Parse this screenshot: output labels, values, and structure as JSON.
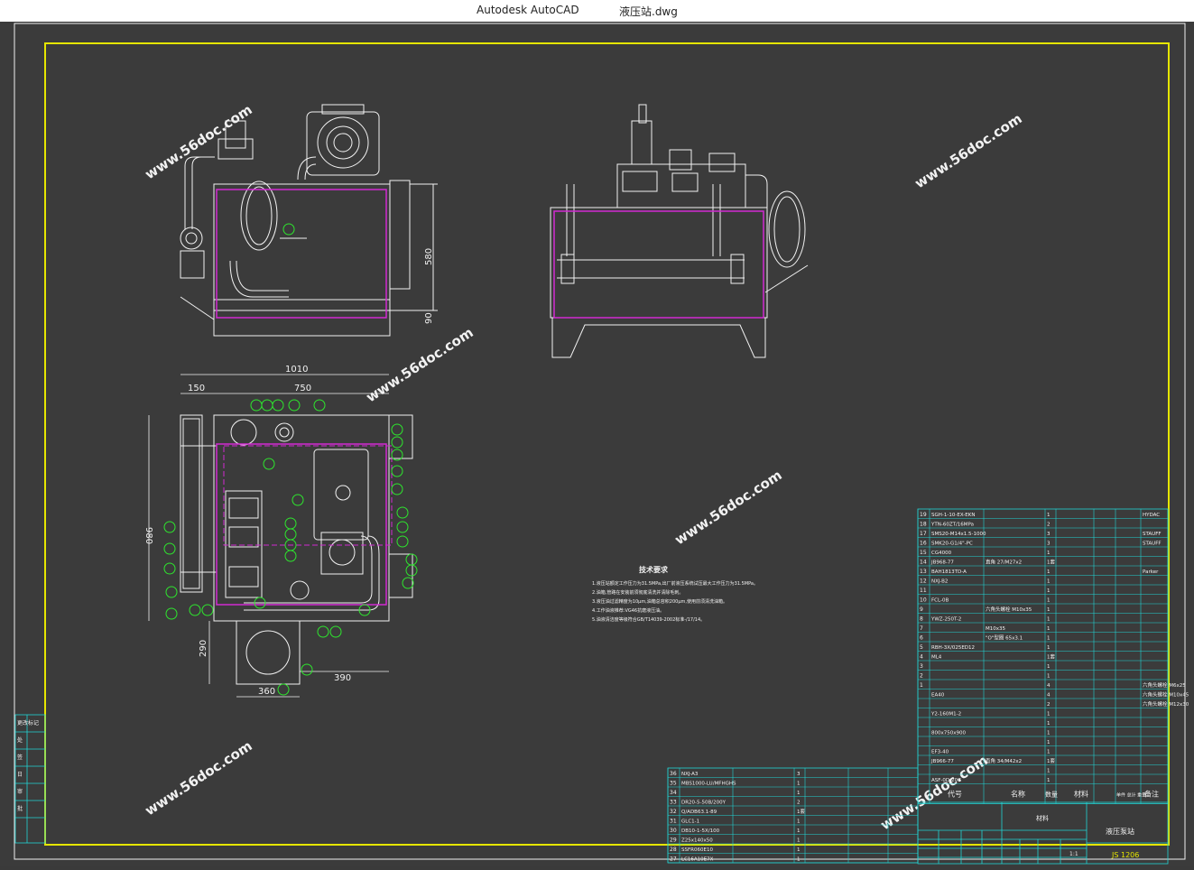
{
  "window": {
    "app_name": "Autodesk AutoCAD",
    "file_name": "液压站.dwg"
  },
  "watermark": "www.56doc.com",
  "colors": {
    "frame": "#e6e600",
    "drawing": "#f2f2f2",
    "magenta": "#d22ad2",
    "cyan": "#22d4d4",
    "green": "#2ee62e",
    "background": "#3b3b3b"
  },
  "dims": {
    "d1010": "1010",
    "d150": "150",
    "d750": "750",
    "d980": "980",
    "d290": "290",
    "d390": "390",
    "d360": "360",
    "d580": "580",
    "d90": "90"
  },
  "notes": {
    "title": "技术要求",
    "lines": [
      "1.液压站额定工作压力为31.5MPa,出厂前液压系统试压最大工作压力为31.5MPa。",
      "2.油箱,管路在安装前须彻底清洗并清除毛刺。",
      "3.液压油过滤精度为10μm,油箱总容积200μm,使用前须清洗油箱。",
      "4.工作油液推荐:VG46抗磨液压油。",
      "5.油液清洁度等级符合GB/T14039-2002标准-/17/14。"
    ]
  },
  "bom_right": {
    "header": {
      "no": "序号",
      "code": "代号",
      "name": "名称",
      "qty": "数量",
      "material": "材料",
      "weight": "单件 总计 重量",
      "remark": "备注"
    },
    "rows": [
      {
        "no": "19",
        "code": "SGH-1-10-EX-EKN",
        "name": "",
        "qty": "1",
        "remark": "HYDAC"
      },
      {
        "no": "18",
        "code": "YTN-60ZT/16MPa",
        "name": "",
        "qty": "2",
        "remark": ""
      },
      {
        "no": "17",
        "code": "SMS20-M14x1.5-1000",
        "name": "",
        "qty": "3",
        "remark": "STAUFF"
      },
      {
        "no": "16",
        "code": "SMK20-G1/4\"-PC",
        "name": "",
        "qty": "3",
        "remark": "STAUFF"
      },
      {
        "no": "15",
        "code": "CG4000",
        "name": "",
        "qty": "1",
        "remark": ""
      },
      {
        "no": "14",
        "code": "JB968-77",
        "name": "直角 27/M27x2",
        "qty": "1套",
        "remark": ""
      },
      {
        "no": "13",
        "code": "BAH1813TD-A",
        "name": "",
        "qty": "1",
        "remark": "Parker"
      },
      {
        "no": "12",
        "code": "NXJ-B2",
        "name": "",
        "qty": "1",
        "remark": ""
      },
      {
        "no": "11",
        "code": "",
        "name": "",
        "qty": "1",
        "remark": ""
      },
      {
        "no": "10",
        "code": "FCL-0B",
        "name": "",
        "qty": "1",
        "remark": ""
      },
      {
        "no": "9",
        "code": "",
        "name": "六角头螺栓 M10x35",
        "qty": "1",
        "remark": ""
      },
      {
        "no": "8",
        "code": "YWZ-250T-2",
        "name": "",
        "qty": "1",
        "remark": ""
      },
      {
        "no": "7",
        "code": "",
        "name": "M10x35",
        "qty": "1",
        "remark": ""
      },
      {
        "no": "6",
        "code": "",
        "name": "\"O\"型圈 65x3.1",
        "qty": "1",
        "remark": ""
      },
      {
        "no": "5",
        "code": "RBH-3X/025ED12",
        "name": "",
        "qty": "1",
        "remark": ""
      },
      {
        "no": "4",
        "code": "ML4",
        "name": "",
        "qty": "1套",
        "remark": ""
      },
      {
        "no": "3",
        "code": "",
        "name": "",
        "qty": "1",
        "remark": ""
      },
      {
        "no": "2",
        "code": "",
        "name": "",
        "qty": "1",
        "remark": ""
      },
      {
        "no": "1",
        "code": "",
        "name": "",
        "qty": "4",
        "remark": "六角头螺栓 M6x25"
      },
      {
        "no": "",
        "code": "EA40",
        "name": "",
        "qty": "4",
        "remark": "六角头螺栓 M10x45"
      },
      {
        "no": "",
        "code": "",
        "name": "",
        "qty": "2",
        "remark": "六角头螺栓 M12x30"
      },
      {
        "no": "",
        "code": "Y2-160M1-2",
        "name": "",
        "qty": "1",
        "remark": ""
      },
      {
        "no": "",
        "code": "",
        "name": "",
        "qty": "1",
        "remark": ""
      },
      {
        "no": "",
        "code": "800x750x900",
        "name": "",
        "qty": "1",
        "remark": ""
      },
      {
        "no": "",
        "code": "",
        "name": "",
        "qty": "1",
        "remark": ""
      },
      {
        "no": "",
        "code": "EF3-40",
        "name": "",
        "qty": "1",
        "remark": ""
      },
      {
        "no": "",
        "code": "JB966-77",
        "name": "直角 34/M42x2",
        "qty": "1套",
        "remark": ""
      },
      {
        "no": "",
        "code": "",
        "name": "",
        "qty": "1",
        "remark": ""
      },
      {
        "no": "",
        "code": "ASF-0D-20C",
        "name": "",
        "qty": "1",
        "remark": ""
      }
    ]
  },
  "bom_left": {
    "rows": [
      {
        "no": "36",
        "code": "NXJ-A3",
        "qty": "3",
        "remark": ""
      },
      {
        "no": "35",
        "code": "MBS1000-LU/MFHGHS",
        "qty": "1",
        "remark": ""
      },
      {
        "no": "34",
        "code": "",
        "qty": "1",
        "remark": ""
      },
      {
        "no": "33",
        "code": "DR20-5-50B/200Y",
        "qty": "2",
        "remark": ""
      },
      {
        "no": "32",
        "code": "Q/ADB63.1-89",
        "qty": "1套",
        "remark": ""
      },
      {
        "no": "31",
        "code": "GLC1-1",
        "qty": "1",
        "remark": ""
      },
      {
        "no": "30",
        "code": "DB10-1-5X/100",
        "qty": "1",
        "remark": ""
      },
      {
        "no": "29",
        "code": "Z25x140x50",
        "qty": "1",
        "remark": ""
      },
      {
        "no": "28",
        "code": "SSFR060E10",
        "qty": "1",
        "remark": ""
      },
      {
        "no": "27",
        "code": "LC16A10E7X",
        "qty": "1",
        "remark": ""
      }
    ]
  },
  "title_block": {
    "drawing_name": "液压泵站",
    "drawing_no": "JS 1206",
    "scale": "1:1",
    "material_label": "材料"
  },
  "revision_strip": [
    "更改标记",
    "处",
    "签",
    "日",
    "审",
    "批"
  ]
}
